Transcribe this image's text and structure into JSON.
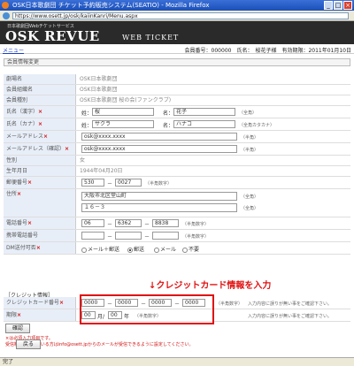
{
  "window": {
    "title": "OSK日本歌劇団 チケット予約販売システム(SEATIO) - Mozilla Firefox",
    "url": "https://www.osett.jp/osk/kaiinKanri/Menu.aspx"
  },
  "banner": {
    "subtitle": "日本歌劇団Webチケットサービス",
    "logo": "OSK REVUE",
    "logo_suffix": "WEB TICKET"
  },
  "infobar": {
    "menu_link": "メニュー",
    "member_info": "会員番号：000000　氏名：　桜花子様　有効期限：2011年01月10日"
  },
  "section_title": "会員情報変更",
  "fields": {
    "theater_label": "劇場名",
    "theater_value": "OSK日本歌劇団",
    "org_label": "会員組織名",
    "org_value": "OSK日本歌劇団",
    "type_label": "会員種別",
    "type_value": "OSK日本歌劇団 桜の会(ファンクラブ)",
    "name_label": "氏名（漢字）",
    "name_last_prefix": "姓：",
    "name_last": "桜",
    "name_first_prefix": "名：",
    "name_first": "花子",
    "name_fw_note": "（全角）",
    "kana_label": "氏名（カナ）",
    "kana_last_prefix": "姓：",
    "kana_last": "サクラ",
    "kana_first_prefix": "名：",
    "kana_first": "ハナコ",
    "kana_note": "（全角カタカナ）",
    "email_label": "メールアドレス",
    "email_value": "osk@xxxx.xxxx",
    "email_note": "（半角）",
    "email_confirm_label": "メールアドレス（確認）",
    "email_confirm_value": "osk@xxxx.xxxx",
    "email_confirm_note": "（半角）",
    "gender_label": "性別",
    "gender_value": "女",
    "birth_label": "生年月日",
    "birth_value": "1944年04月20日",
    "zip_label": "郵便番号",
    "zip1": "530",
    "zip_sep": "－",
    "zip2": "0027",
    "zip_note": "（半角数字）",
    "address_label": "住所",
    "address1": "大阪市北区堂山町",
    "address1_note": "（全角）",
    "address2": "１６－３",
    "address2_note": "（全角）",
    "phone_label": "電話番号",
    "phone1": "06",
    "phone_sep1": "－",
    "phone2": "6362",
    "phone_sep2": "－",
    "phone3": "8838",
    "phone_note": "（半角数字）",
    "mobile_label": "携帯電話番号",
    "mobile_sep1": "－",
    "mobile_sep2": "－",
    "mobile_note": "（半角数字）",
    "dm_label": "DM送付可否",
    "dm_options": [
      "メール＋郵送",
      "郵送",
      "メール",
      "不要"
    ],
    "dm_selected": "郵送"
  },
  "credit": {
    "section_title": "［クレジット情報］",
    "annotation": "↓クレジットカード情報を入力",
    "card_label": "クレジットカード番号",
    "card1": "0000",
    "card2": "0000",
    "card3": "0000",
    "card4": "0000",
    "card_sep": "－",
    "card_note": "（半角数字）",
    "card_hint": "入力内容に誤りが無い事をご確認下さい。",
    "expiry_label": "期限",
    "expiry_month": "00",
    "expiry_month_suffix": "月/",
    "expiry_year": "00",
    "expiry_year_suffix": "年",
    "expiry_note": "（半角数字）",
    "expiry_hint": "入力内容に誤りが無い事をご確認下さい。"
  },
  "confirm_button": "確認",
  "required_note": "×は必須入力項目です。",
  "mail_note": "受信制限を行っている方はinfo@osett.jpからのメールが受信できるように設定してください。",
  "back_button": "戻る",
  "status": "完了",
  "colors": {
    "required": "#d01010",
    "annotation": "#e01010",
    "banner": "#2a2a2a"
  }
}
